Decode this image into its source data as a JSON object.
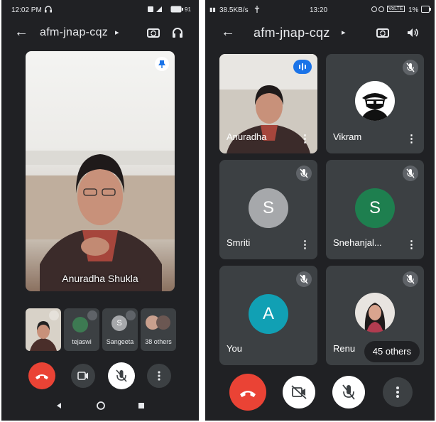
{
  "left": {
    "status": {
      "time": "12:02 PM",
      "battery": "91"
    },
    "meeting_code": "afm-jnap-cqz",
    "main_speaker": "Anuradha Shukla",
    "thumbnails": [
      "",
      "tejaswi",
      "Sangeeta",
      "38 others"
    ],
    "thumb_initial": "S"
  },
  "right": {
    "status": {
      "speed": "38.5KB/s",
      "time": "13:20",
      "volte": "VoLTE",
      "battery": "1%"
    },
    "meeting_code": "afm-jnap-cqz",
    "tiles": [
      {
        "name": "Anuradha",
        "initial": ""
      },
      {
        "name": "Vikram",
        "initial": ""
      },
      {
        "name": "Smriti",
        "initial": "S"
      },
      {
        "name": "Snehanjal...",
        "initial": "S"
      },
      {
        "name": "You",
        "initial": "A"
      },
      {
        "name": "Renu",
        "initial": ""
      }
    ],
    "others": "45 others",
    "more_glyph": "⋮"
  },
  "colors": {
    "end_call": "#ea4335",
    "avatar_gray": "#a6a8ab",
    "avatar_green": "#1e7f4f",
    "avatar_teal": "#11a0b4",
    "speaking": "#1a73e8"
  }
}
